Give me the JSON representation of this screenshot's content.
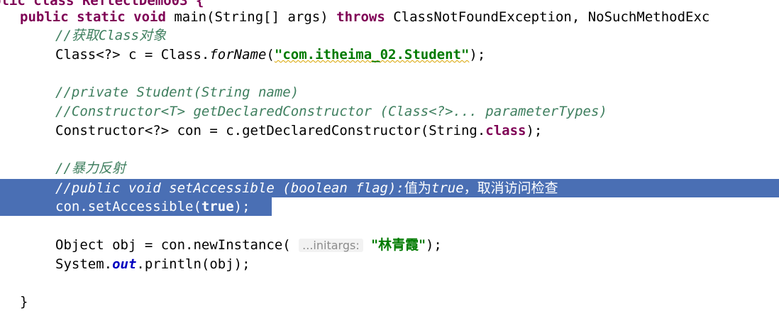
{
  "editor": {
    "line1": {
      "prefix": "blic class ReflectDemo03 {"
    },
    "line2": {
      "kw1": "public static void",
      "sig": " main(String[] args) ",
      "kw2": "throws",
      "exc": " ClassNotFoundException, NoSuchMethodExc"
    },
    "line3": {
      "comment": "//获取Class对象"
    },
    "line4": {
      "code1": "Class<?> c = Class.",
      "method": "forName",
      "open": "(",
      "string": "\"com.itheima_02.Student\"",
      "close": ");"
    },
    "line5": {
      "comment": "//private Student(String name)"
    },
    "line6": {
      "comment": "//Constructor<T> getDeclaredConstructor (Class<?>... parameterTypes)"
    },
    "line7": {
      "code1": "Constructor<?> con = c.getDeclaredConstructor(String.",
      "kw": "class",
      "close": ");"
    },
    "line8": {
      "comment": "//暴力反射"
    },
    "line9": {
      "comment_code": "//public void setAccessible (boolean flag):",
      "comment_cn1": "值为",
      "comment_true": "true",
      "comment_cn2": "，取消访问检查"
    },
    "line10": {
      "code1": "con.setAccessible(",
      "kw": "true",
      "close": ");"
    },
    "line11": {
      "code1": "Object obj = con.newInstance( ",
      "hint": "...initargs:",
      "string": "\"林青霞\"",
      "close": ");"
    },
    "line12": {
      "code1": "System.",
      "field": "out",
      "code2": ".println(obj);"
    },
    "line13": {
      "brace": "}"
    }
  },
  "colors": {
    "keyword": "#7f0055",
    "comment": "#3f7f5f",
    "string": "#007a00",
    "selection": "#4a6fb4"
  }
}
